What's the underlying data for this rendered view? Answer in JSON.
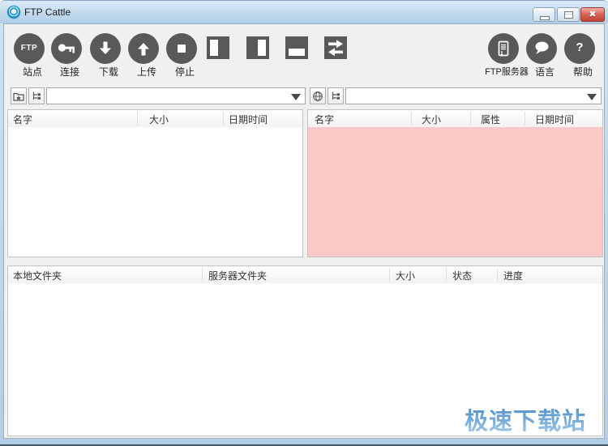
{
  "window": {
    "title": "FTP Cattle"
  },
  "toolbar": {
    "left_buttons": [
      {
        "icon": "ftp-site-icon",
        "icon_text": "FTP",
        "label": "站点"
      },
      {
        "icon": "key-icon",
        "label": "连接"
      },
      {
        "icon": "download-icon",
        "label": "下载"
      },
      {
        "icon": "upload-icon",
        "label": "上传"
      },
      {
        "icon": "stop-icon",
        "label": "停止"
      }
    ],
    "layout_buttons": [
      {
        "icon": "layout-left-pane-icon"
      },
      {
        "icon": "layout-right-pane-icon"
      },
      {
        "icon": "layout-bottom-pane-icon"
      },
      {
        "icon": "transfer-arrows-icon"
      }
    ],
    "right_buttons": [
      {
        "icon": "ftp-server-icon",
        "label": "FTP服务器"
      },
      {
        "icon": "language-bubble-icon",
        "label": "语言"
      },
      {
        "icon": "help-icon",
        "icon_text": "?",
        "label": "帮助"
      }
    ]
  },
  "local_panel": {
    "address_value": "",
    "columns": [
      "名字",
      "大小",
      "日期时间"
    ]
  },
  "remote_panel": {
    "address_value": "",
    "columns": [
      "名字",
      "大小",
      "属性",
      "日期时间"
    ],
    "highlight_bg": "#fcc7c7"
  },
  "transfer_queue": {
    "columns": [
      "本地文件夹",
      "服务器文件夹",
      "大小",
      "状态",
      "进度"
    ]
  },
  "watermark": {
    "text": "极速下载站",
    "color": "#5b9bd0"
  }
}
